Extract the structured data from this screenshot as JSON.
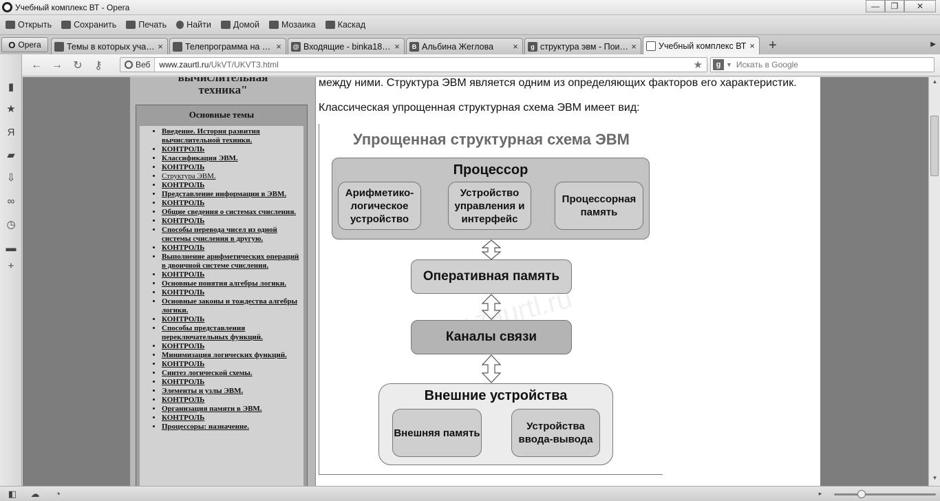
{
  "window": {
    "title": "Учебный комплекс ВТ - Opera",
    "minimize": "—",
    "maximize": "❐",
    "close": "✕"
  },
  "menu": [
    "Открыть",
    "Сохранить",
    "Печать",
    "Найти",
    "Домой",
    "Мозаика",
    "Каскад"
  ],
  "opera_button": "Opera",
  "tabs": [
    {
      "label": "Темы в которых участ...",
      "favicon": "page-icon",
      "fav": ""
    },
    {
      "label": "Телепрограмма на се...",
      "favicon": "tv-icon",
      "fav": ""
    },
    {
      "label": "Входящие - binka1808...",
      "favicon": "mail-icon",
      "fav": "@"
    },
    {
      "label": "Альбина Жеглова",
      "favicon": "vk-icon",
      "fav": "В"
    },
    {
      "label": "структура эвм - Поис...",
      "favicon": "google-icon",
      "fav": "g"
    },
    {
      "label": "Учебный комплекс ВТ",
      "favicon": "document-icon",
      "fav": ""
    }
  ],
  "address": {
    "badge": "Веб",
    "host": "www.zaurtl.ru",
    "path": "/UkVT/UKVT3.html",
    "search_placeholder": "Искать в Google"
  },
  "site": {
    "title_line1": "вычислительная",
    "title_line2": "техника\"",
    "themes_heading": "Основные темы",
    "themes": [
      "Введение. История развития вычислительной техники.",
      "КОНТРОЛЬ",
      "Классификация ЭВМ.",
      "КОНТРОЛЬ",
      "Структура ЭВМ.",
      "КОНТРОЛЬ",
      "Представление информации в ЭВМ.",
      "КОНТРОЛЬ",
      "Общие сведения о системах счисления.",
      "КОНТРОЛЬ",
      "Способы перевода чисел из одной системы счисления в другую.",
      "КОНТРОЛЬ",
      "Выполнение арифметических операций в двоичной системе счисления.",
      "КОНТРОЛЬ",
      "Основные понятия алгебры логики.",
      "КОНТРОЛЬ",
      "Основные законы и тождества алгебры логики.",
      "КОНТРОЛЬ",
      "Способы представления переключательных функций.",
      "КОНТРОЛЬ",
      "Минимизация логических функций.",
      "КОНТРОЛЬ",
      "Синтез логической схемы.",
      "КОНТРОЛЬ",
      "Элементы и узлы ЭВМ.",
      "КОНТРОЛЬ",
      "Организация памяти в ЭВМ.",
      "КОНТРОЛЬ",
      "Процессоры: назначение."
    ]
  },
  "content": {
    "para1": "между ними. Структура ЭВМ является одним из определяющих факторов его характеристик.",
    "para2": "Классическая упрощенная структурная схема ЭВМ имеет вид:"
  },
  "diagram": {
    "title": "Упрощенная структурная схема ЭВМ",
    "processor": "Процессор",
    "alu": "Арифметико-логическое устройство",
    "control": "Устройство управления и интерфейс",
    "cpu_memory": "Процессорная память",
    "ram": "Оперативная память",
    "channels": "Каналы связи",
    "external": "Внешние устройства",
    "ext_memory": "Внешняя память",
    "io": "Устройства ввода-вывода",
    "watermark": "www.zaurtl.ru"
  }
}
